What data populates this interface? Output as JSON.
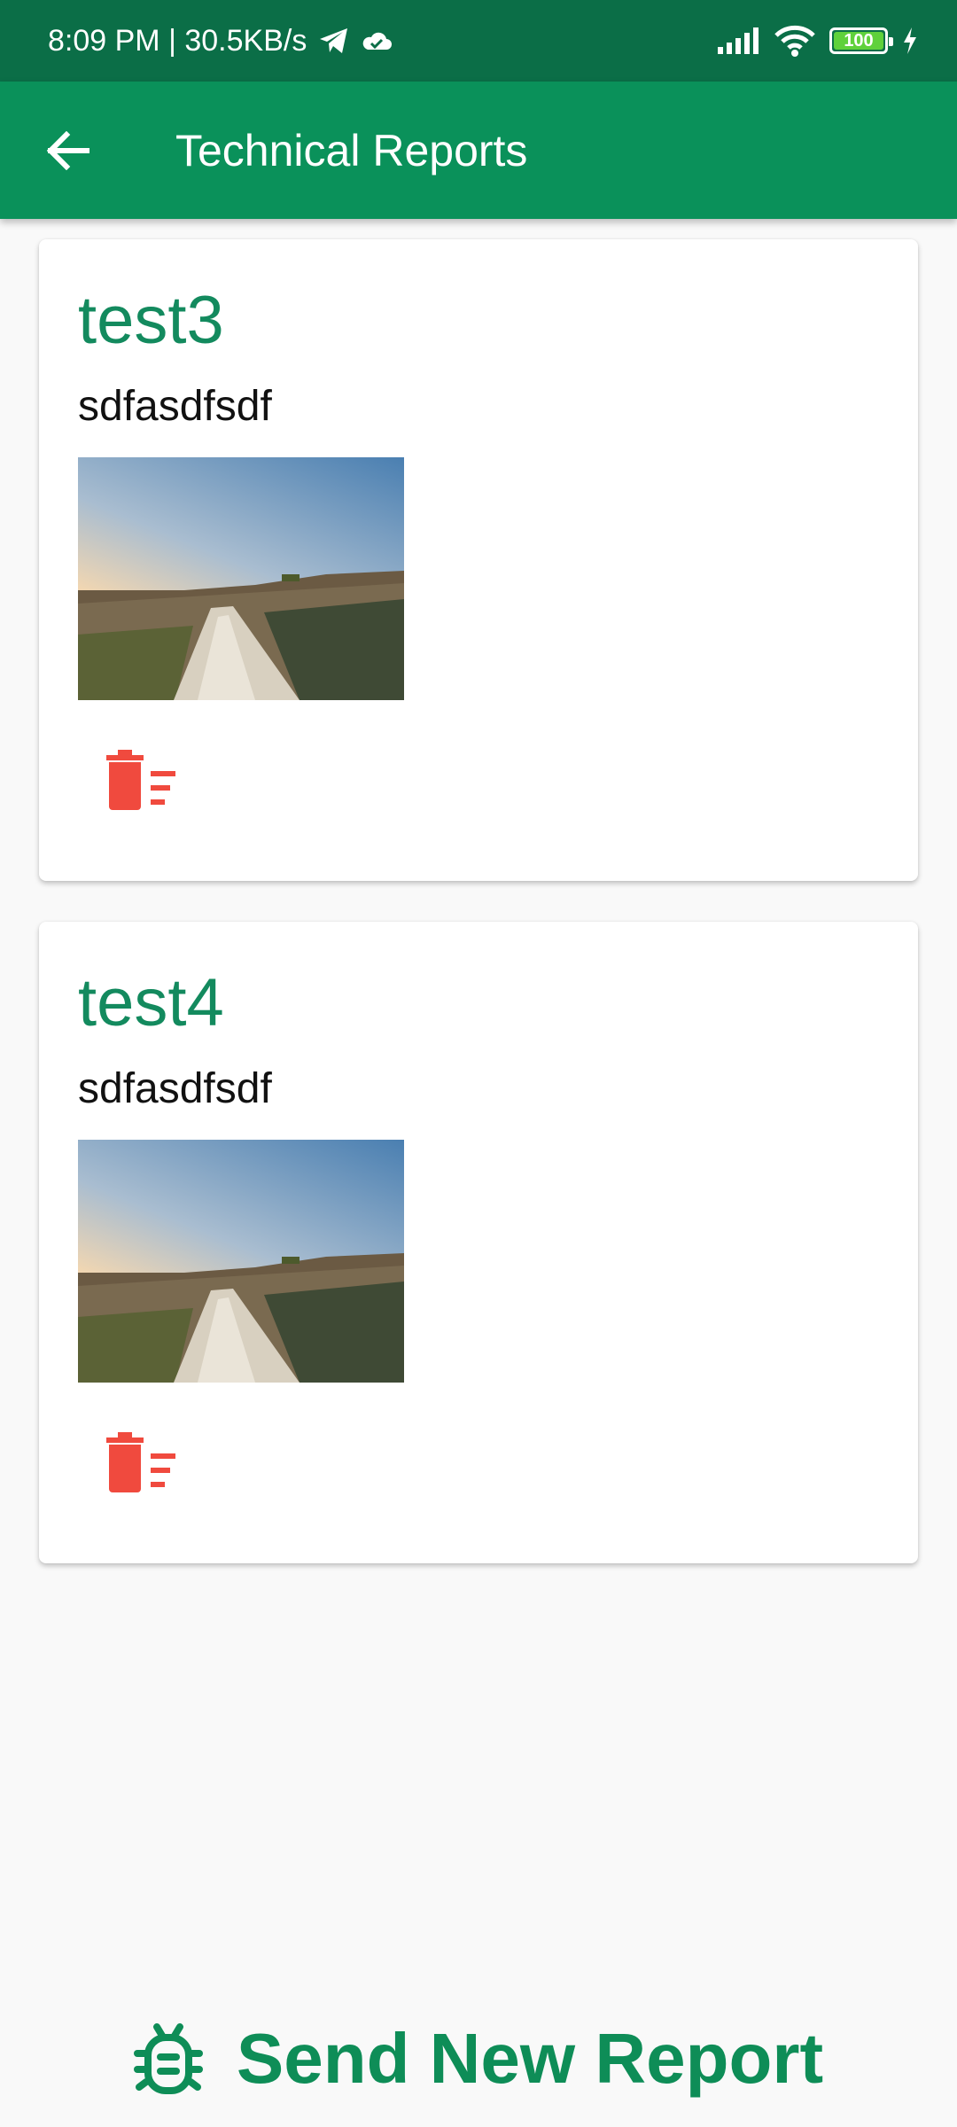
{
  "status_bar": {
    "time_speed": "8:09 PM | 30.5KB/s",
    "battery": "100",
    "icons": [
      "telegram-icon",
      "cloud-icon",
      "signal-icon",
      "wifi-icon",
      "battery-icon",
      "charging-icon"
    ]
  },
  "app_bar": {
    "title": "Technical Reports",
    "back_icon": "arrow-back-icon"
  },
  "reports": [
    {
      "title": "test3",
      "description": "sdfasdfsdf",
      "image": "landscape-photo",
      "delete_icon": "delete-sweep-icon"
    },
    {
      "title": "test4",
      "description": "sdfasdfsdf",
      "image": "landscape-photo",
      "delete_icon": "delete-sweep-icon"
    }
  ],
  "footer": {
    "send_label": "Send New Report",
    "icon": "bug-icon"
  },
  "colors": {
    "status_bar": "#0b6e47",
    "app_bar": "#0a915a",
    "accent_green": "#138a5e",
    "delete_red": "#f04a3e",
    "background": "#f9f9f9"
  }
}
